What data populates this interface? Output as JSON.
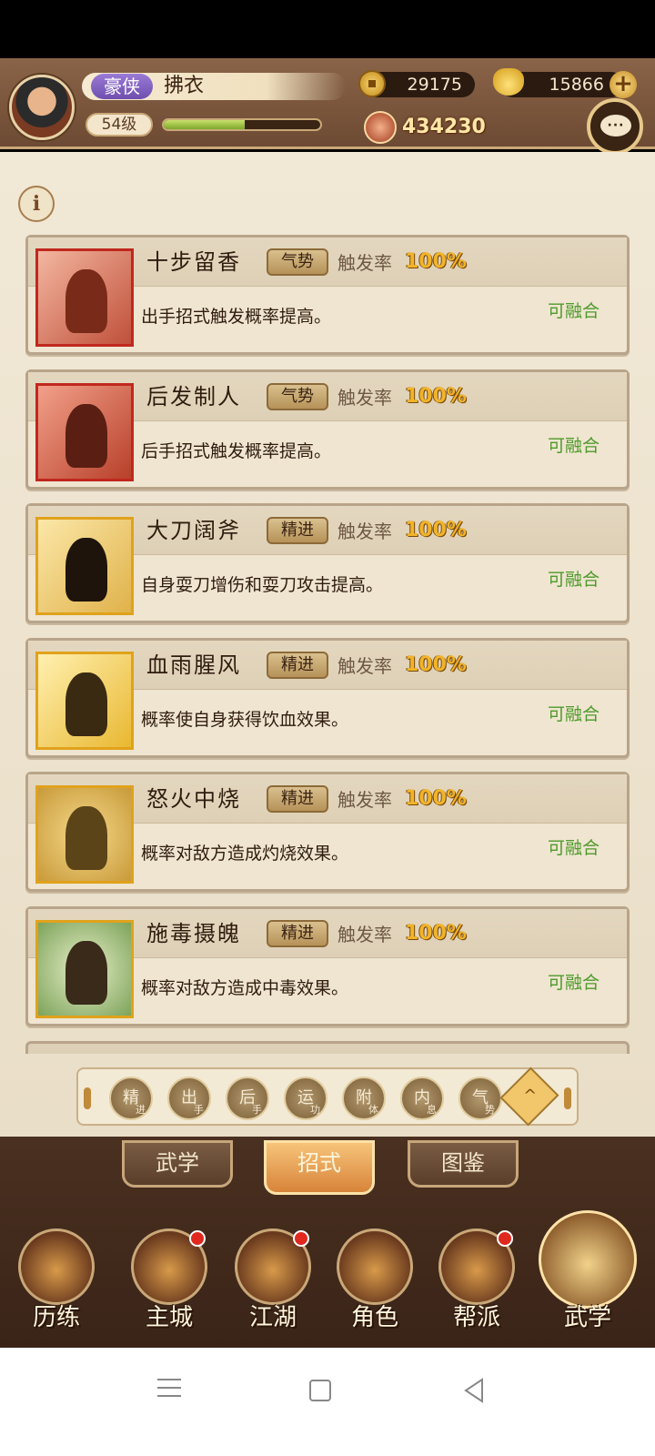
{
  "player": {
    "rank": "豪侠",
    "name": "拂衣",
    "level": "54级",
    "exp_fraction": 0.52,
    "coins": "29175",
    "gold": "15866",
    "power": "434230"
  },
  "skills": [
    {
      "name": "十步留香",
      "tag": "气势",
      "trigger_label": "触发率",
      "trigger_value": "100%",
      "desc": "出手招式触发概率提高。",
      "status": "可融合"
    },
    {
      "name": "后发制人",
      "tag": "气势",
      "trigger_label": "触发率",
      "trigger_value": "100%",
      "desc": "后手招式触发概率提高。",
      "status": "可融合"
    },
    {
      "name": "大刀阔斧",
      "tag": "精进",
      "trigger_label": "触发率",
      "trigger_value": "100%",
      "desc": "自身耍刀增伤和耍刀攻击提高。",
      "status": "可融合"
    },
    {
      "name": "血雨腥风",
      "tag": "精进",
      "trigger_label": "触发率",
      "trigger_value": "100%",
      "desc": "概率使自身获得饮血效果。",
      "status": "可融合"
    },
    {
      "name": "怒火中烧",
      "tag": "精进",
      "trigger_label": "触发率",
      "trigger_value": "100%",
      "desc": "概率对敌方造成灼烧效果。",
      "status": "可融合"
    },
    {
      "name": "施毒摄魄",
      "tag": "精进",
      "trigger_label": "触发率",
      "trigger_value": "100%",
      "desc": "概率对敌方造成中毒效果。",
      "status": "可融合"
    }
  ],
  "filters": [
    {
      "main": "精",
      "sub": "进"
    },
    {
      "main": "出",
      "sub": "手"
    },
    {
      "main": "后",
      "sub": "手"
    },
    {
      "main": "运",
      "sub": "功"
    },
    {
      "main": "附",
      "sub": "体"
    },
    {
      "main": "内",
      "sub": "息"
    },
    {
      "main": "气",
      "sub": "势"
    }
  ],
  "tabs": [
    "武学",
    "招式",
    "图鉴"
  ],
  "active_tab": "招式",
  "nav": [
    "历练",
    "主城",
    "江湖",
    "角色",
    "帮派",
    "武学"
  ],
  "active_nav": "武学",
  "colors": {
    "trigger_value": "#f1b42a",
    "fuse_status": "#4d9a2a",
    "notification_dot": "#e0281e"
  },
  "icons": {
    "info": "i",
    "plus": "+",
    "chat_dots": "···",
    "collapse": "^"
  }
}
